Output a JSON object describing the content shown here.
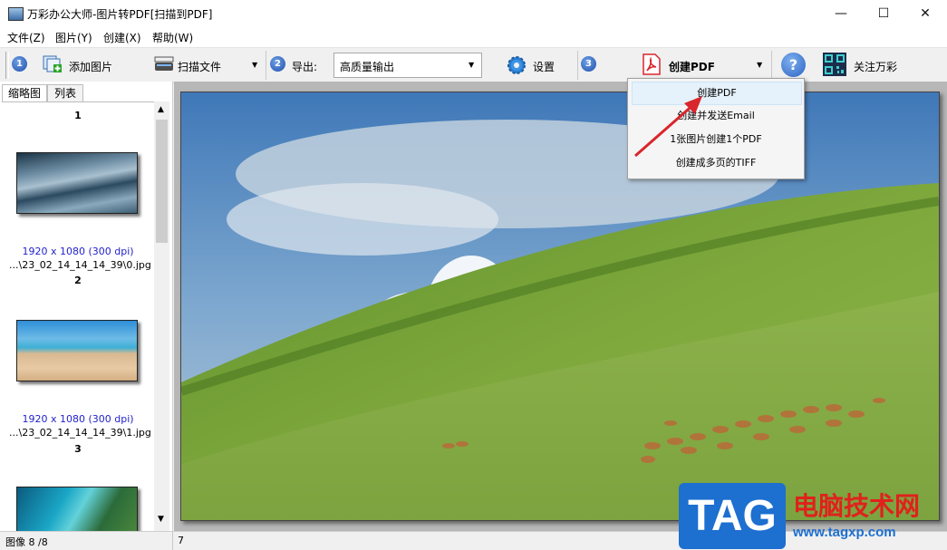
{
  "window": {
    "title": "万彩办公大师-图片转PDF[扫描到PDF]",
    "minimize": "—",
    "maximize": "☐",
    "close": "✕"
  },
  "menu": [
    "文件(Z)",
    "图片(Y)",
    "创建(X)",
    "帮助(W)"
  ],
  "toolbar": {
    "step1": "1",
    "add_images": "添加图片",
    "scan_file": "扫描文件",
    "step2": "2",
    "export_label": "导出:",
    "export_value": "高质量输出",
    "settings": "设置",
    "step3": "3",
    "create_pdf": "创建PDF",
    "help": "?",
    "follow": "关注万彩"
  },
  "tabs": [
    "缩略图",
    "列表"
  ],
  "thumbnails": [
    {
      "num": "1",
      "dims": "1920 x 1080 (300 dpi)",
      "file": "...\\23_02_14_14_14_39\\0.jpg"
    },
    {
      "num": "2",
      "dims": "1920 x 1080 (300 dpi)",
      "file": "...\\23_02_14_14_14_39\\1.jpg"
    },
    {
      "num": "3"
    }
  ],
  "dropdown": [
    "创建PDF",
    "创建并发送Email",
    "1张图片创建1个PDF",
    "创建成多页的TIFF"
  ],
  "status": {
    "left": "图像 8 /8",
    "mid": "7"
  },
  "watermark": {
    "tag": "TAG",
    "site_name": "电脑技术网",
    "url": "www.tagxp.com"
  },
  "colors": {
    "accent": "#1f4fa8",
    "pdf_red": "#d9262c",
    "selected": "#e5f1fb"
  }
}
